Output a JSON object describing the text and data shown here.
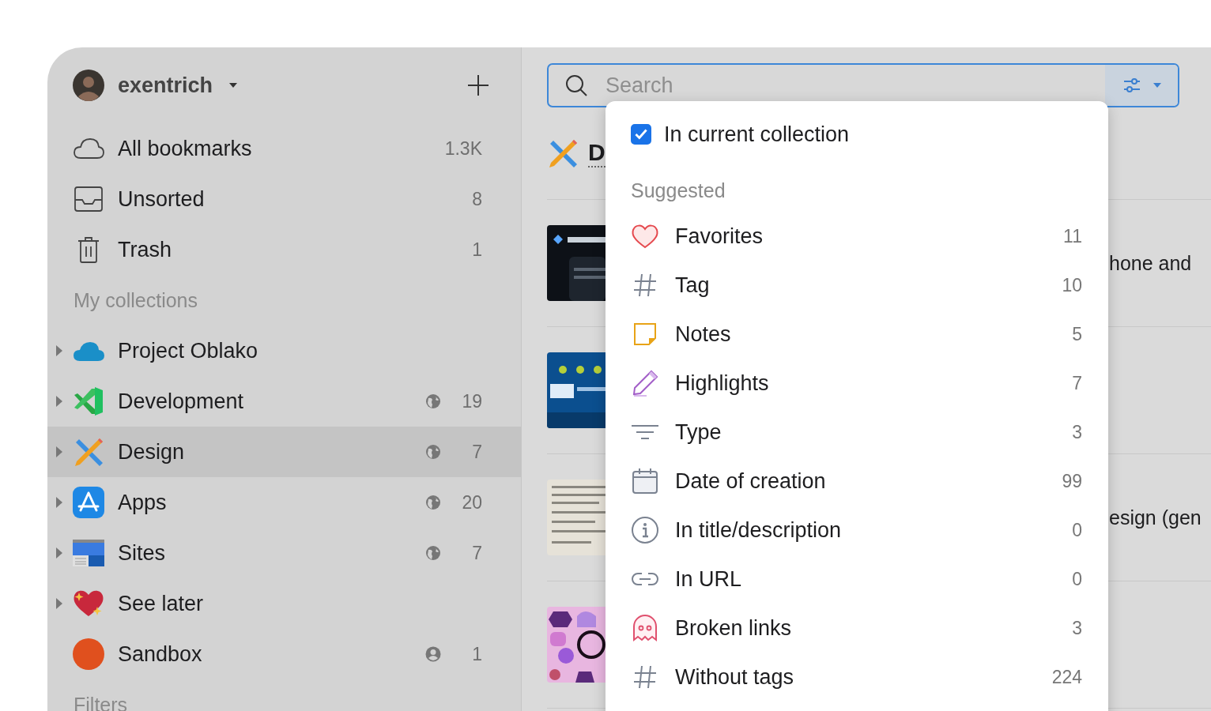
{
  "account": {
    "name": "exentrich"
  },
  "nav": [
    {
      "label": "All bookmarks",
      "count": "1.3K"
    },
    {
      "label": "Unsorted",
      "count": "8"
    },
    {
      "label": "Trash",
      "count": "1"
    }
  ],
  "collections_heading": "My collections",
  "collections": [
    {
      "label": "Project Oblako",
      "has_children": true,
      "expanded": false,
      "selected": false
    },
    {
      "label": "Development",
      "has_children": true,
      "expanded": false,
      "selected": false,
      "public": true,
      "count": "19"
    },
    {
      "label": "Design",
      "has_children": true,
      "expanded": false,
      "selected": true,
      "public": true,
      "count": "7"
    },
    {
      "label": "Apps",
      "has_children": true,
      "expanded": false,
      "selected": false,
      "public": true,
      "count": "20"
    },
    {
      "label": "Sites",
      "has_children": true,
      "expanded": false,
      "selected": false,
      "public": true,
      "count": "7"
    },
    {
      "label": "See later",
      "has_children": true,
      "expanded": false,
      "selected": false
    },
    {
      "label": "Sandbox",
      "has_children": false,
      "selected": false,
      "public": false,
      "count": "1"
    }
  ],
  "filters_heading": "Filters",
  "search": {
    "placeholder": "Search"
  },
  "collection_header": {
    "title": "D"
  },
  "bookmarks": [
    {
      "kind": "picture",
      "title": "hone and"
    },
    {
      "kind": "picture"
    },
    {
      "kind": "picture",
      "title": "esign (gen"
    },
    {
      "kind": "picture"
    }
  ],
  "dropdown": {
    "scope": {
      "label": "In current collection",
      "checked": true
    },
    "heading": "Suggested",
    "items": [
      {
        "label": "Favorites",
        "count": "11"
      },
      {
        "label": "Tag",
        "count": "10"
      },
      {
        "label": "Notes",
        "count": "5"
      },
      {
        "label": "Highlights",
        "count": "7"
      },
      {
        "label": "Type",
        "count": "3"
      },
      {
        "label": "Date of creation",
        "count": "99"
      },
      {
        "label": "In title/description",
        "count": "0"
      },
      {
        "label": "In URL",
        "count": "0"
      },
      {
        "label": "Broken links",
        "count": "3"
      },
      {
        "label": "Without tags",
        "count": "224"
      }
    ]
  }
}
